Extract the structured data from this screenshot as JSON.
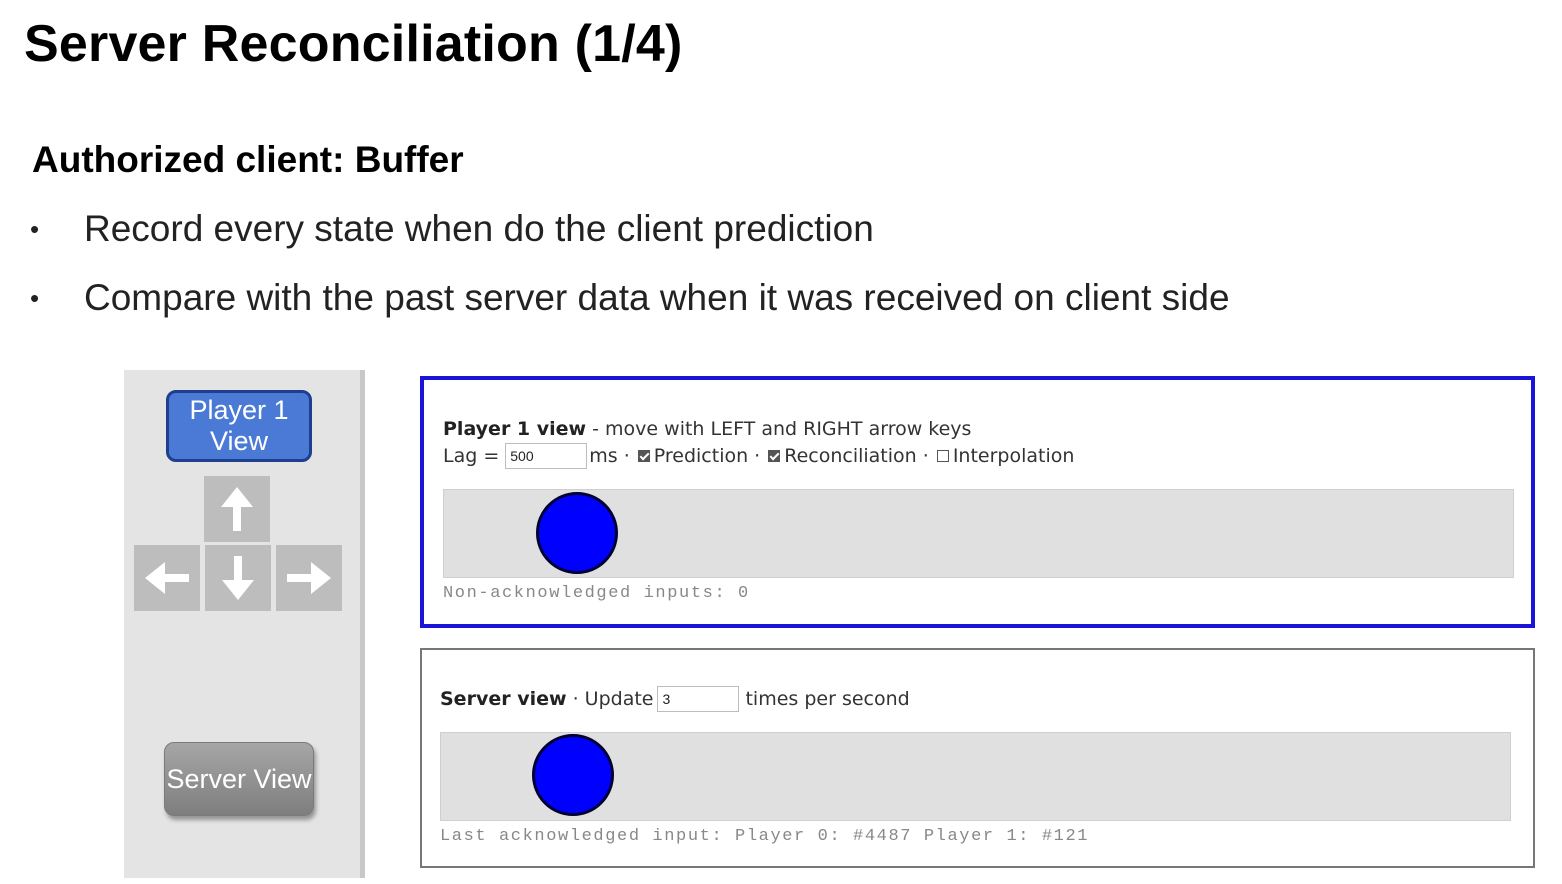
{
  "slide": {
    "title": "Server Reconciliation (1/4)",
    "subtitle": "Authorized client: Buffer",
    "bullets": [
      "Record every state when do the client prediction",
      "Compare with the past server data when it was received on client side"
    ],
    "bullet_glyph": "•"
  },
  "controls": {
    "player_view_button": "Player 1 View",
    "server_view_button": "Server View",
    "arrow_keys": [
      "up-arrow-icon",
      "left-arrow-icon",
      "down-arrow-icon",
      "right-arrow-icon"
    ]
  },
  "player_view": {
    "heading": "Player 1 view",
    "instructions": " - move with LEFT and RIGHT arrow keys",
    "lag_label": "Lag =",
    "lag_value": "500",
    "lag_unit": "ms ·",
    "options": [
      {
        "label": "Prediction",
        "checked": true,
        "suffix": " ·"
      },
      {
        "label": "Reconciliation",
        "checked": true,
        "suffix": " ·"
      },
      {
        "label": "Interpolation",
        "checked": false,
        "suffix": ""
      }
    ],
    "status": "Non-acknowledged inputs: 0",
    "ball_color": "#0000ff",
    "border_color": "#1a14d8"
  },
  "server_view": {
    "heading": "Server view",
    "update_label": " · Update",
    "update_value": "3",
    "update_unit": "times per second",
    "status": "Last acknowledged input: Player 0: #4487 Player 1: #121",
    "ball_color": "#0000ff"
  }
}
